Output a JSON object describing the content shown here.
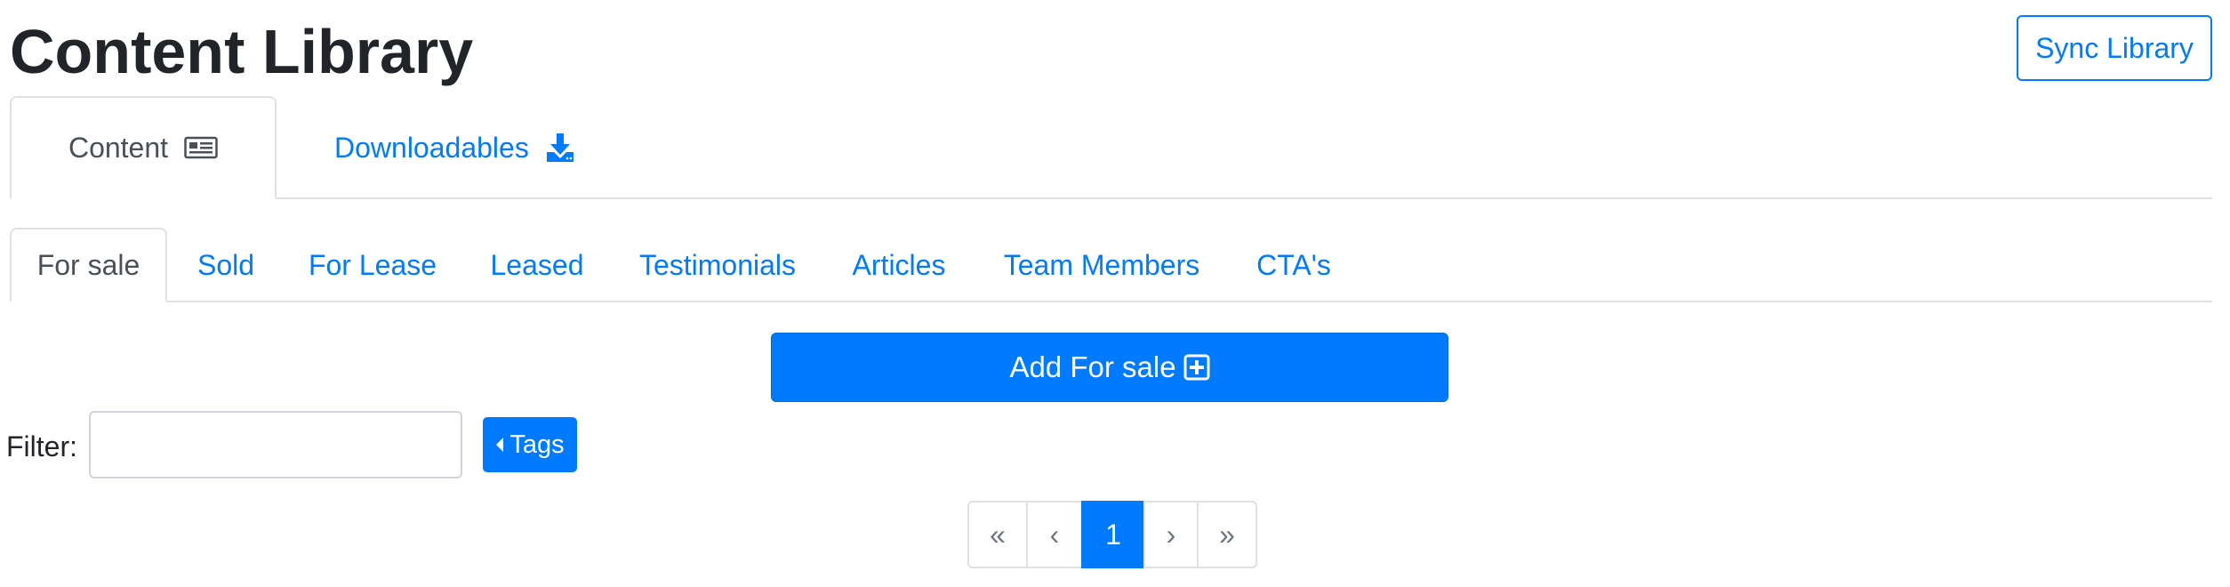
{
  "header": {
    "title": "Content Library",
    "sync_label": "Sync Library"
  },
  "top_tabs": [
    {
      "label": "Content",
      "icon": "newspaper-icon",
      "active": true
    },
    {
      "label": "Downloadables",
      "icon": "download-icon",
      "active": false
    }
  ],
  "sub_tabs": [
    {
      "label": "For sale",
      "active": true
    },
    {
      "label": "Sold",
      "active": false
    },
    {
      "label": "For Lease",
      "active": false
    },
    {
      "label": "Leased",
      "active": false
    },
    {
      "label": "Testimonials",
      "active": false
    },
    {
      "label": "Articles",
      "active": false
    },
    {
      "label": "Team Members",
      "active": false
    },
    {
      "label": "CTA's",
      "active": false
    }
  ],
  "add_button": {
    "label": "Add For sale",
    "icon": "plus-square-icon"
  },
  "filter": {
    "label": "Filter:",
    "value": "",
    "placeholder": ""
  },
  "tags_button": {
    "label": "Tags",
    "icon": "caret-left-icon"
  },
  "pagination": {
    "first": "«",
    "prev": "‹",
    "current": "1",
    "next": "›",
    "last": "»"
  },
  "colors": {
    "accent": "#007bff",
    "text": "#212529",
    "muted": "#6c757d",
    "border": "#dee2e6"
  }
}
